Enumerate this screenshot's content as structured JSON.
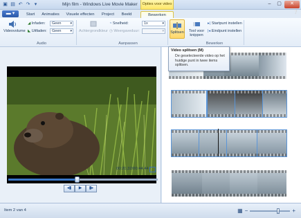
{
  "window": {
    "title": "Mijn film - Windows Live Movie Maker",
    "context_tab_header": "Opties voor video",
    "close_glyph": "✕",
    "minimize_glyph": "–",
    "maximize_glyph": "▢"
  },
  "tabs": [
    "Start",
    "Animaties",
    "Visuele effecten",
    "Project",
    "Beeld",
    "Bewerken"
  ],
  "active_tab": "Bewerken",
  "ribbon": {
    "audio": {
      "group_label": "Audio",
      "videovolume": "Videovolume",
      "infaden_label": "Infaden:",
      "infaden_value": "Geen",
      "uitfaden_label": "Uitfaden:",
      "uitfaden_value": "Geen"
    },
    "aanpassen": {
      "group_label": "Aanpassen",
      "achtergrondkleur": "Achtergrondkleur",
      "snelheid_label": "Snelheid:",
      "snelheid_value": "1x",
      "weergaveduur_label": "Weergaveduur:"
    },
    "bewerken": {
      "group_label": "Bewerken",
      "splitsen": "Splitsen",
      "tool_voor_knippen_1": "Tool voor",
      "tool_voor_knippen_2": "knippen",
      "startpunt": "Startpunt instellen",
      "eindpunt": "Eindpunt instellen"
    }
  },
  "tooltip": {
    "title": "Video splitsen (M)",
    "body": "De geselecteerde video op het huidige punt in twee items splitsen."
  },
  "preview": {
    "timecode": "00:20,32/00:44,44",
    "progress_fraction": 0.46
  },
  "status": {
    "text": "Item 2 van 4",
    "zoom_fraction": 0.7
  },
  "colors": {
    "accent": "#3a78c9",
    "selection": "#5a95d8",
    "context_tab": "#ffe86a"
  }
}
